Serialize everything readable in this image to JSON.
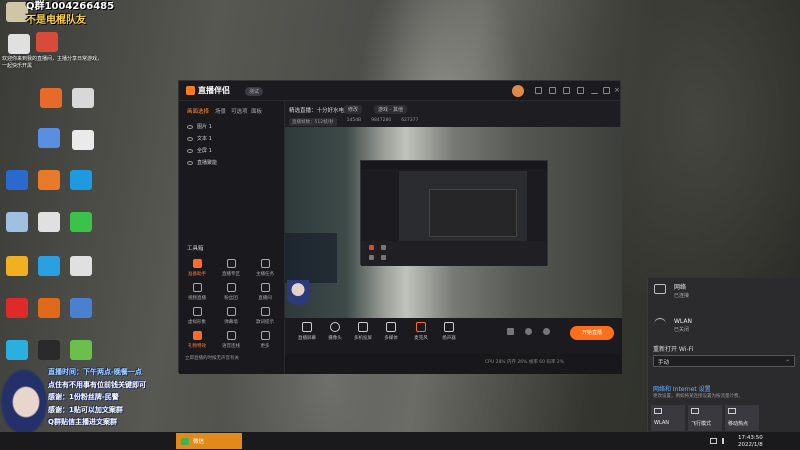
{
  "overlay": {
    "qq_group": "Q群1004266485",
    "qq_group_sub": "不是电棍队友",
    "left_desc": "欢迎你来到我的直播间，主播分享日常游戏，一起快乐开黑",
    "bottom_lines": [
      "直播时间：下午两点-晚餐一点",
      "点住有不用事有位前钱关键即可",
      "感谢：1份粉丝牌-民警",
      "感谢：1贴可以加文案群",
      "Q群贴信主播进文案群"
    ]
  },
  "app": {
    "name": "直播伴侣",
    "version": "测试",
    "tabs": [
      "画面选择",
      "场景",
      "可选项",
      "面板"
    ],
    "layers": [
      "图片 1",
      "文本 1",
      "全屏 1",
      "直播聚能"
    ],
    "tools_title": "工具箱",
    "tools": [
      "准备助手",
      "直播专区",
      "主播任务",
      "视频直播",
      "粉丝团",
      "直播间",
      "虚拟形象",
      "弹幕墙",
      "歌词提示",
      "礼物特效",
      "语音连线",
      "更多"
    ],
    "stream_title": "精选直播：十分好水电脑一",
    "stream_tag": "修改",
    "stream_category": "游戏 - 其他",
    "stats": [
      "直播帧数：512帧/秒",
      "1d5dB",
      "9847280",
      "627377"
    ],
    "bottom_controls": [
      "直播屏幕",
      "摄像头",
      "多机投屏",
      "多媒体",
      "麦克风",
      "扬声器"
    ],
    "start_label": "开始直播",
    "notice": "立即直播的时候无声音有关",
    "status": "CPU 28%  内存 26%  帧率 60  码率 2%"
  },
  "network": {
    "items": [
      {
        "name": "网络",
        "status": "已连接"
      },
      {
        "name": "WLAN",
        "status": "已关闭"
      }
    ],
    "reopen_label": "重新打开 Wi-Fi",
    "reopen_value": "手动",
    "settings_link": "网络和 Internet 设置",
    "settings_sub": "更改设置，例如将某连接设置为按流量计费。",
    "quick_tiles": [
      "WLAN",
      "飞行模式",
      "移动热点"
    ]
  },
  "taskbar": {
    "app_label": "微信",
    "time": "17:43:50",
    "date": "2022/1/8"
  },
  "colors": {
    "accent": "#ff6e1a",
    "link": "#6cb4ff",
    "taskbar_app": "#e08a1a"
  }
}
